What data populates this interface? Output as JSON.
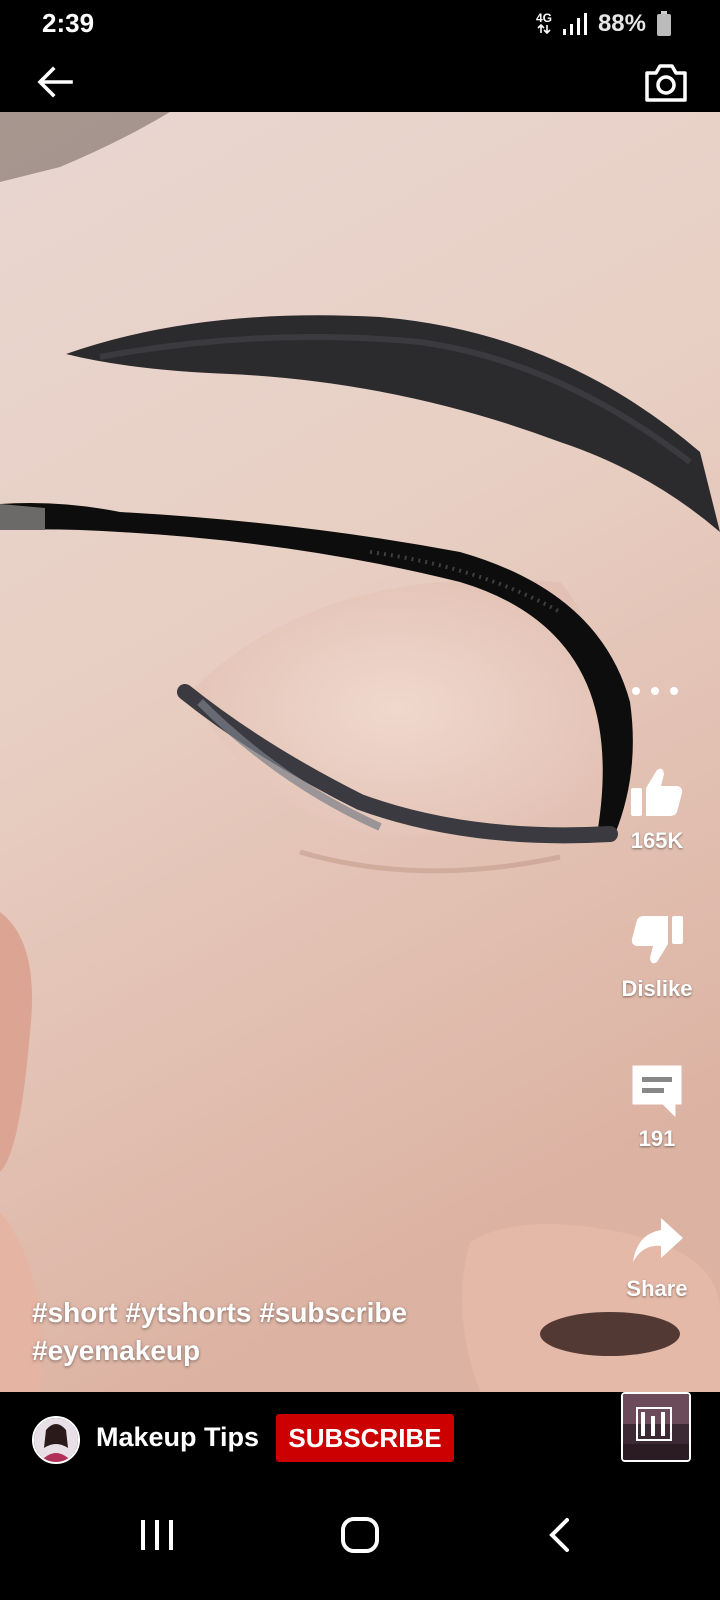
{
  "status_bar": {
    "time": "2:39",
    "network": "4G",
    "battery": "88%"
  },
  "top_bar": {
    "back_icon": "arrow-left-icon",
    "camera_icon": "camera-icon"
  },
  "actions": {
    "like_count": "165K",
    "dislike_label": "Dislike",
    "comment_count": "191",
    "share_label": "Share"
  },
  "caption": {
    "hashtags": [
      "#short",
      "#ytshorts",
      "#subscribe",
      "#eyemakeup"
    ]
  },
  "channel": {
    "name": "Makeup Tips",
    "subscribe_label": "SUBSCRIBE"
  },
  "colors": {
    "subscribe": "#cc0000",
    "background": "#000000",
    "text": "#ffffff"
  }
}
